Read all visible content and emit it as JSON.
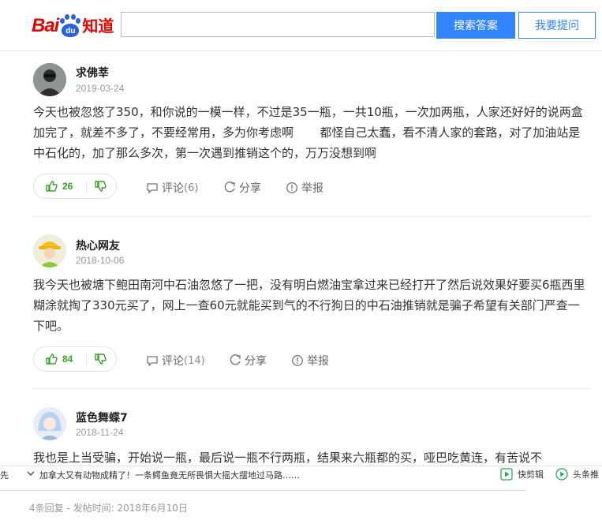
{
  "header": {
    "logo_bai": "Bai",
    "logo_du": "du",
    "logo_zhidao": "知道",
    "search_placeholder": "",
    "search_button": "搜索答案",
    "ask_button": "我要提问"
  },
  "answers": [
    {
      "user": "求佛莘",
      "date": "2019-03-24",
      "content": "今天也被忽悠了350，和你说的一模一样，不过是35一瓶，一共10瓶，一次加两瓶，人家还好好的说两盒加完了，就差不多了，不要经常用，多为你考虑啊       都怪自己太蠢，看不清人家的套路，对了加油站是中石化的，加了那么多次，第一次遇到推销这个的，万万没想到啊",
      "likes": "26",
      "comment_label": "评论",
      "comment_count": "(6)",
      "share_label": "分享",
      "report_label": "举报"
    },
    {
      "user": "热心网友",
      "date": "2018-10-06",
      "content": "我今天也被塘下鲍田南河中石油忽悠了一把，没有明白燃油宝拿过来已经打开了然后说效果好要买6瓶西里糊涂就掏了330元买了，网上一查60元就能买到气的不行狗日的中石油推销就是骗子希望有关部门严查一下吧。",
      "likes": "84",
      "comment_label": "评论",
      "comment_count": "(14)",
      "share_label": "分享",
      "report_label": "举报"
    },
    {
      "user": "蓝色舞蝶7",
      "date": "2018-11-24",
      "content": "我也是上当受骗，开始说一瓶，最后说一瓶不行两瓶，结果来六瓶都的买，哑巴吃黄连，有苦说不"
    }
  ],
  "ticker": {
    "left_fragment": "先",
    "news": "加拿大又有动物成精了！一条鳄鱼竟无所畏惧大摇大摆地过马路……",
    "btn1": "快剪辑",
    "btn2": "头条推"
  },
  "footer": {
    "info": "4条回复 - 发帖时间: 2018年6月10日"
  },
  "colors": {
    "accent": "#3385ff",
    "brand_red": "#e10601",
    "like_green": "#3aa02a"
  }
}
